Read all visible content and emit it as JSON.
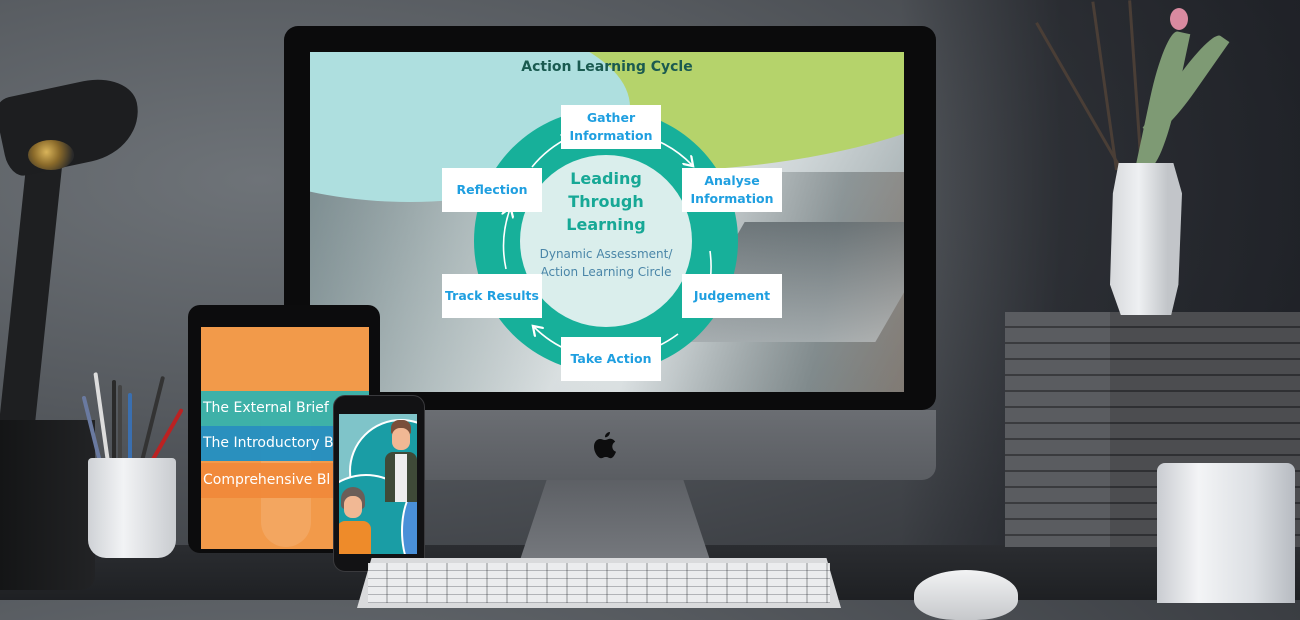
{
  "scene": "Devices mockup on desk showing e-learning course screens",
  "monitor": {
    "brand_logo": "apple-logo",
    "slide": {
      "title": "Action Learning Cycle",
      "center_title": "Leading Through Learning",
      "center_subtitle": "Dynamic Assessment/ Action Learning Circle",
      "stages": [
        {
          "label": "Gather Information"
        },
        {
          "label": "Analyse Information"
        },
        {
          "label": "Judgement"
        },
        {
          "label": "Take Action"
        },
        {
          "label": "Track Results"
        },
        {
          "label": "Reflection"
        }
      ],
      "colors": {
        "ring": "#17b09a",
        "stage_text": "#1f9fe0",
        "title_text": "#1a5a50",
        "banner_green": "#b5d36b",
        "banner_teal": "#aedfdf"
      }
    }
  },
  "tablet": {
    "menu_items": [
      {
        "label": "The External Brief",
        "color": "#2fb3b0"
      },
      {
        "label": "The Introductory B",
        "color": "#1f8fc4"
      },
      {
        "label": "Comprehensive Bl",
        "color": "#f0893a"
      }
    ],
    "background_color": "#f29a4a"
  },
  "phone": {
    "content": "illustrated-avatars",
    "colors": {
      "bubble": "#1a9da5",
      "accent": "#4a90d8"
    }
  }
}
